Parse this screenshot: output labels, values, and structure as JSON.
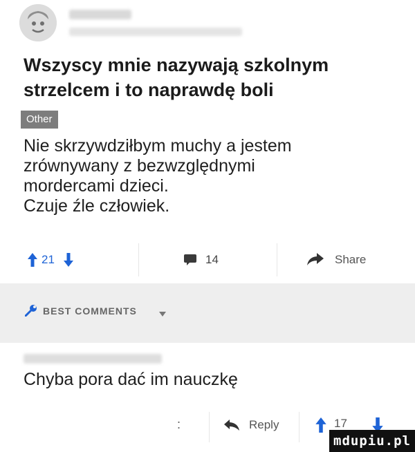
{
  "post": {
    "title": "Wszyscy mnie nazywają szkolnym strzelcem i to naprawdę boli",
    "tag": "Other",
    "body": "Nie skrzywdziłbym muchy a jestem\nzrównywany z bezwzględnymi\nmordercami dzieci.\nCzuje źle człowiek."
  },
  "actions": {
    "votes": "21",
    "comments": "14",
    "share_label": "Share"
  },
  "best_comments": {
    "label": "BEST COMMENTS"
  },
  "comment": {
    "text": "Chyba pora dać im nauczkę",
    "more": ":",
    "reply_label": "Reply",
    "votes": "17"
  },
  "watermark": {
    "text": "mdupiu.pl"
  },
  "colors": {
    "accent_blue": "#1e63d6",
    "tag_bg": "#7d7d7d",
    "band_bg": "#eeeeee"
  },
  "icons": [
    "avatar-face-icon",
    "upvote-arrow-icon",
    "downvote-arrow-icon",
    "comment-icon",
    "share-arrow-icon",
    "wrench-icon",
    "chevron-down-icon",
    "reply-arrow-icon"
  ]
}
